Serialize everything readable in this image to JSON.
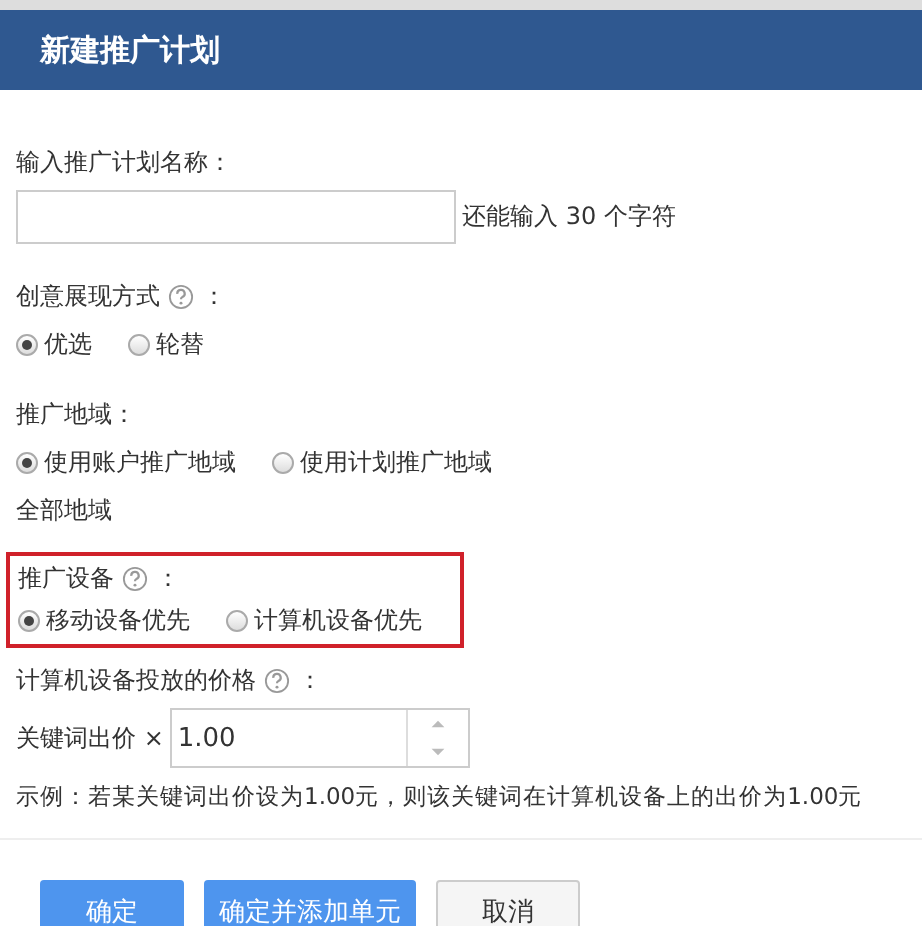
{
  "dialog": {
    "title": "新建推广计划"
  },
  "name_field": {
    "label": "输入推广计划名称：",
    "hint": "还能输入 30 个字符"
  },
  "display_mode": {
    "label": "创意展现方式",
    "colon": "：",
    "options": [
      {
        "label": "优选",
        "selected": true
      },
      {
        "label": "轮替",
        "selected": false
      }
    ]
  },
  "region": {
    "label": "推广地域：",
    "options": [
      {
        "label": "使用账户推广地域",
        "selected": true
      },
      {
        "label": "使用计划推广地域",
        "selected": false
      }
    ],
    "note": "全部地域"
  },
  "device": {
    "label": "推广设备",
    "colon": "：",
    "highlighted": true,
    "options": [
      {
        "label": "移动设备优先",
        "selected": true
      },
      {
        "label": "计算机设备优先",
        "selected": false
      }
    ]
  },
  "price": {
    "label": "计算机设备投放的价格",
    "colon": "：",
    "prefix": "关键词出价 ×",
    "value": "1.00",
    "example": "示例：若某关键词出价设为1.00元，则该关键词在计算机设备上的出价为1.00元"
  },
  "buttons": [
    {
      "label": "确定",
      "kind": "primary"
    },
    {
      "label": "确定并添加单元",
      "kind": "primary"
    },
    {
      "label": "取消",
      "kind": "secondary"
    }
  ]
}
